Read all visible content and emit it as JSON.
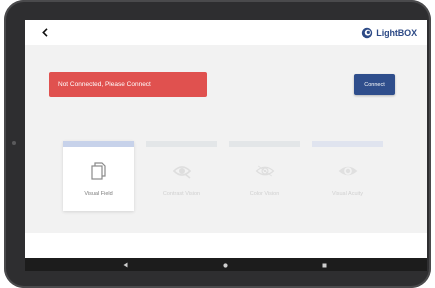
{
  "app": {
    "brand_name": "LightBOX",
    "brand_color": "#2d4a86"
  },
  "header": {
    "back_icon": "chevron-left-icon",
    "logo_icon": "lightbox-logo-icon"
  },
  "connection": {
    "status_text": "Not Connected, Please Connect",
    "status_color": "#e0514f",
    "connect_label": "Connect",
    "connect_color": "#2f4e8c"
  },
  "tests": [
    {
      "label": "Visual Field",
      "icon": "document-copy-icon",
      "enabled": true
    },
    {
      "label": "Contrast Vision",
      "icon": "contrast-eye-icon",
      "enabled": false
    },
    {
      "label": "Color Vision",
      "icon": "color-eye-icon",
      "enabled": false
    },
    {
      "label": "Visual Acuity",
      "icon": "eye-icon",
      "enabled": false
    }
  ],
  "navbar": {
    "buttons": [
      "back-triangle-icon",
      "home-circle-icon",
      "recents-square-icon"
    ]
  }
}
